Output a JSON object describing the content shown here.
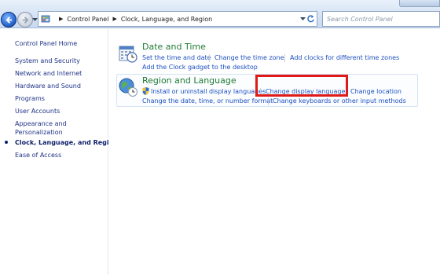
{
  "address_bar": {
    "crumbs": [
      "Control Panel",
      "Clock, Language, and Region"
    ]
  },
  "search": {
    "placeholder": "Search Control Panel"
  },
  "sidebar": {
    "home": "Control Panel Home",
    "items": [
      {
        "label": "System and Security"
      },
      {
        "label": "Network and Internet"
      },
      {
        "label": "Hardware and Sound"
      },
      {
        "label": "Programs"
      },
      {
        "label": "User Accounts"
      },
      {
        "label": "Appearance and",
        "label2": "Personalization"
      },
      {
        "label": "Clock, Language, and Region",
        "current": true
      },
      {
        "label": "Ease of Access"
      }
    ]
  },
  "categories": {
    "date_time": {
      "title": "Date and Time",
      "icon": "calendar-clock-icon",
      "tasks": [
        "Set the time and date",
        "Change the time zone",
        "Add clocks for different time zones",
        "Add the Clock gadget to the desktop"
      ]
    },
    "region_language": {
      "title": "Region and Language",
      "icon": "globe-clock-icon",
      "tasks": [
        "Install or uninstall display languages",
        "Change display language",
        "Change location",
        "Change the date, time, or number format",
        "Change keyboards or other input methods"
      ]
    }
  },
  "colors": {
    "link": "#1c4fbf",
    "category_title": "#1e7a32",
    "highlight": "#e01919",
    "sidebar_link": "#1e3287"
  }
}
